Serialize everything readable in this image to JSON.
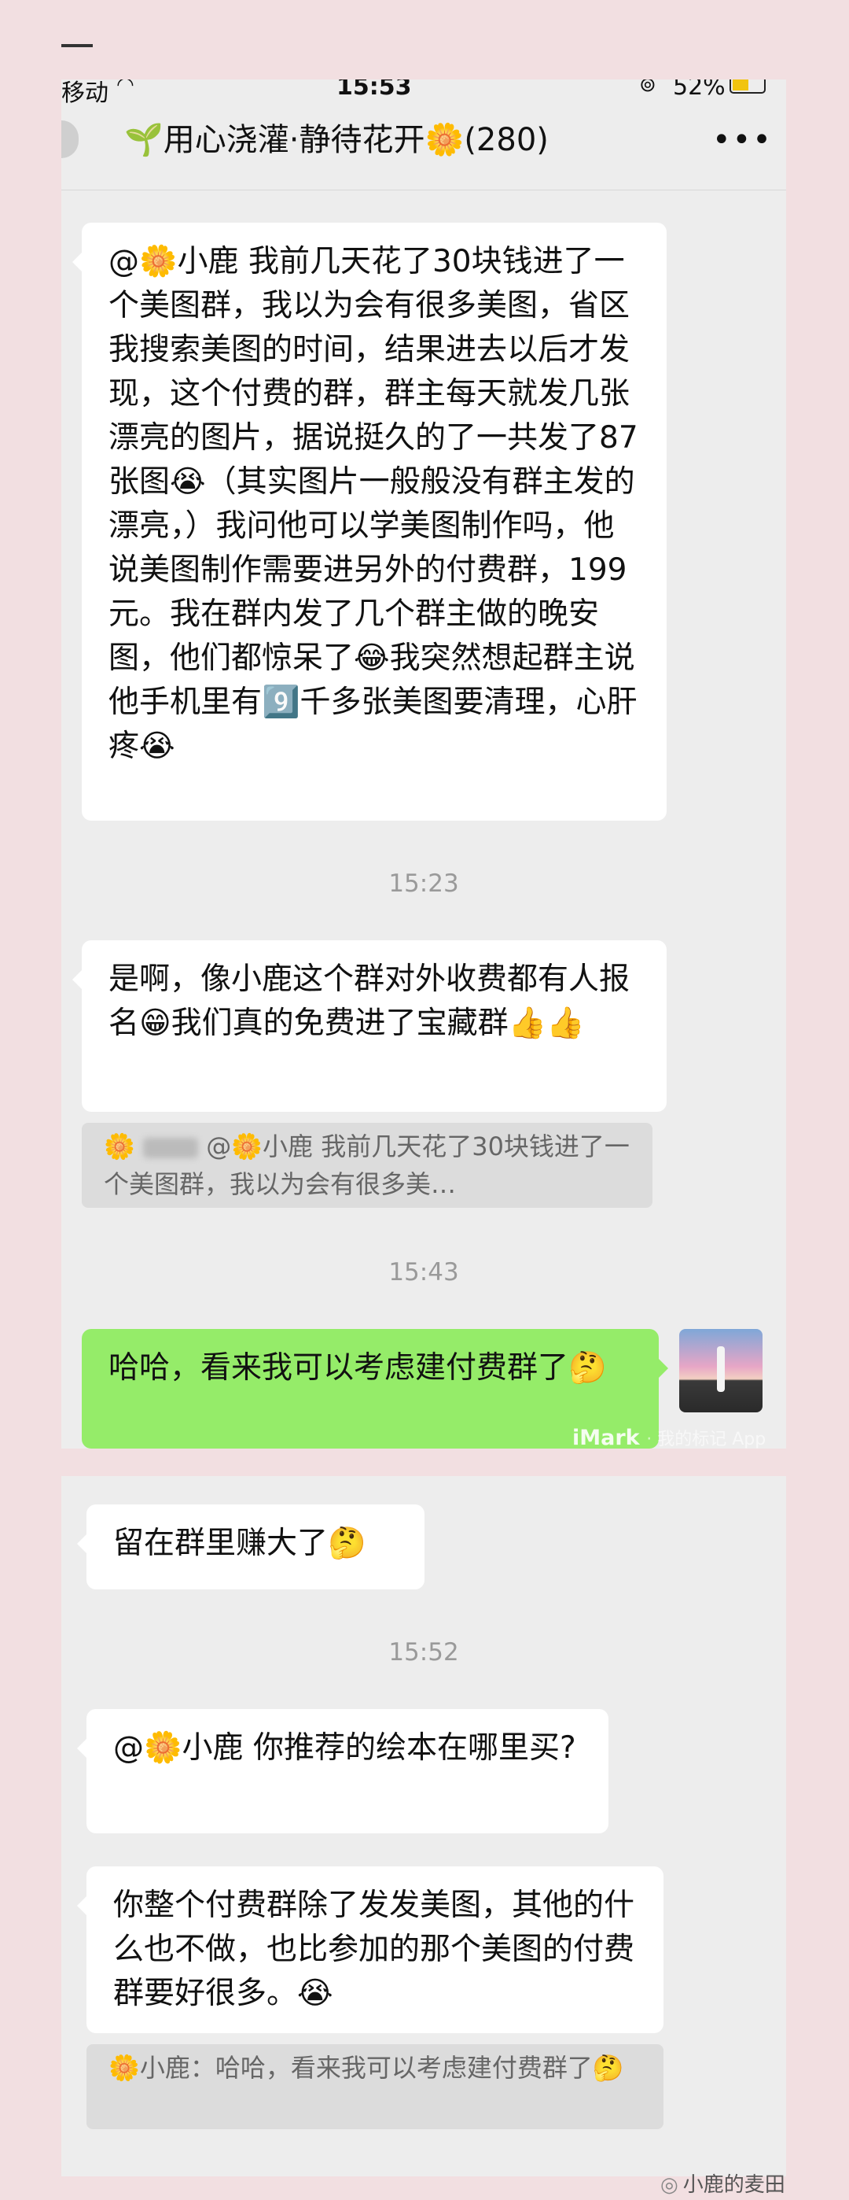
{
  "status_bar": {
    "carrier": "移动",
    "wifi_icon": "wifi-icon",
    "time": "15:53",
    "lock_icon": "rotation-lock-icon",
    "battery": "52%",
    "battery_level": 0.52,
    "battery_color": "#f1c40f"
  },
  "header": {
    "title": "🌱用心浇灌·静待花开🌼",
    "count": "(280)",
    "more": "•••"
  },
  "messages": [
    {
      "text": "@🌼小鹿 我前几天花了30块钱进了一个美图群，我以为会有很多美图，省区我搜索美图的时间，结果进去以后才发现，这个付费的群，群主每天就发几张漂亮的图片，据说挺久的了一共发了87张图😭（其实图片一般般没有群主发的漂亮，）我问他可以学美图制作吗，他说美图制作需要进另外的付费群，199元。我在群内发了几个群主做的晚安图，他们都惊呆了😂我突然想起群主说他手机里有9️⃣千多张美图要清理，心肝疼😭"
    },
    {
      "text": "是啊，像小鹿这个群对外收费都有人报名😁我们真的免费进了宝藏群👍👍"
    },
    {
      "text": "哈哈，看来我可以考虑建付费群了🤔"
    },
    {
      "text": "留在群里赚大了🤔"
    },
    {
      "text": "@🌼小鹿 你推荐的绘本在哪里买?"
    },
    {
      "text": "你整个付费群除了发发美图，其他的什么也不做，也比参加的那个美图的付费群要好很多。😭"
    }
  ],
  "quotes": [
    {
      "author": "🌼",
      "text": "@🌼小鹿 我前几天花了30块钱进了一个美图群，我以为会有很多美…"
    },
    {
      "text": "🌼小鹿：哈哈，看来我可以考虑建付费群了🤔"
    }
  ],
  "timestamps": [
    "15:23",
    "15:43",
    "15:52"
  ],
  "watermark": {
    "brand": "iMark",
    "sub": "· 我的标记 App"
  },
  "footer": {
    "icon": "wechat-icon",
    "text": "小鹿的麦田"
  },
  "colors": {
    "self_bubble": "#95ec69",
    "chat_bg": "#ededed",
    "page_bg": "#f2dfe1"
  }
}
